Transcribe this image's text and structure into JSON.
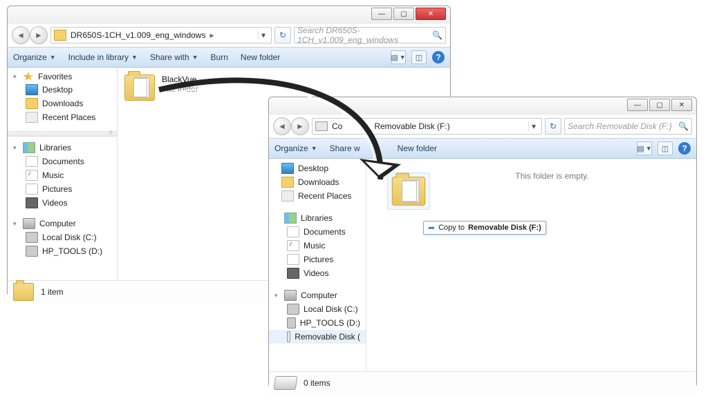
{
  "window1": {
    "titlebar": {
      "min": "—",
      "max": "▢",
      "close": "✕"
    },
    "breadcrumb": {
      "folder": "DR650S-1CH_v1.009_eng_windows",
      "chev": "▸"
    },
    "search_placeholder": "Search DR650S-1CH_v1.009_eng_windows",
    "toolbar": {
      "organize": "Organize",
      "include": "Include in library",
      "share": "Share with",
      "burn": "Burn",
      "newfolder": "New folder",
      "help": "?"
    },
    "tree": {
      "favorites": "Favorites",
      "desktop": "Desktop",
      "downloads": "Downloads",
      "recent": "Recent Places",
      "libraries": "Libraries",
      "documents": "Documents",
      "music": "Music",
      "pictures": "Pictures",
      "videos": "Videos",
      "computer": "Computer",
      "localdisk": "Local Disk (C:)",
      "hptools": "HP_TOOLS (D:)"
    },
    "item": {
      "name": "BlackVue",
      "type": "File folder"
    },
    "status": "1 item"
  },
  "window2": {
    "titlebar": {
      "min": "—",
      "max": "▢",
      "close": "✕"
    },
    "breadcrumb": {
      "prefix": "Co",
      "folder": "Removable Disk (F:)",
      "chev": "▸"
    },
    "search_placeholder": "Search Removable Disk (F:)",
    "toolbar": {
      "organize": "Organize",
      "share": "Share w",
      "newfolder": "New folder",
      "help": "?"
    },
    "tree": {
      "desktop": "Desktop",
      "downloads": "Downloads",
      "recent": "Recent Places",
      "libraries": "Libraries",
      "documents": "Documents",
      "music": "Music",
      "pictures": "Pictures",
      "videos": "Videos",
      "computer": "Computer",
      "localdisk": "Local Disk (C:)",
      "hptools": "HP_TOOLS (D:)",
      "removable": "Removable Disk (",
      "removable_head": "Removable Disk (F:)"
    },
    "empty": "This folder is empty.",
    "drag_tip_prefix": "Copy to ",
    "drag_tip_target": "Removable Disk (F:)",
    "status": "0 items"
  }
}
